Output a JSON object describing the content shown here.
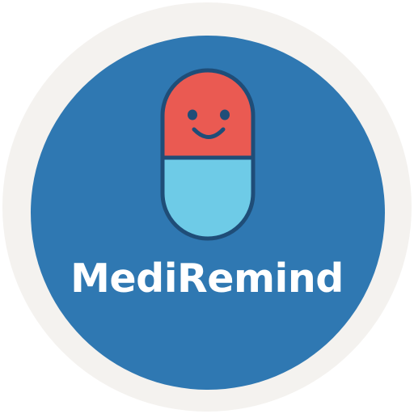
{
  "app": {
    "name": "MediRemind"
  },
  "logo": {
    "icon": "smiling-capsule-icon",
    "colors": {
      "ring": "#f4f2ef",
      "disc": "#2f78b2",
      "capsule_top": "#ea5a52",
      "capsule_bottom": "#6ecbe7",
      "capsule_outline": "#1f4d78",
      "face": "#1f4d78",
      "wordmark": "#ffffff"
    }
  }
}
